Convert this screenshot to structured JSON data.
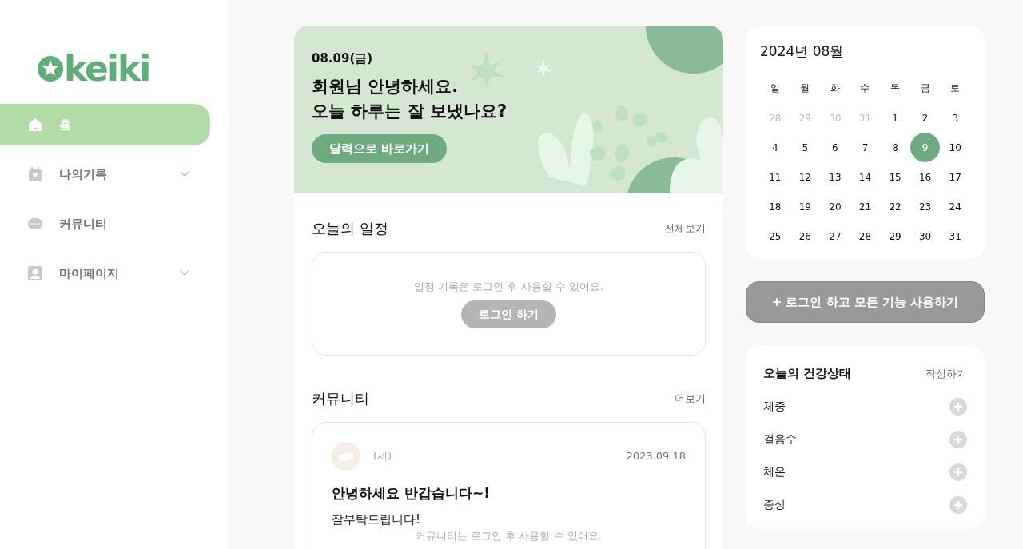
{
  "logo": {
    "text": "keiki"
  },
  "sidebar": {
    "items": [
      {
        "label": "홈",
        "kind": "home",
        "selected": true,
        "expandable": false
      },
      {
        "label": "나의기록",
        "kind": "calendar",
        "selected": false,
        "expandable": true
      },
      {
        "label": "커뮤니티",
        "kind": "chat",
        "selected": false,
        "expandable": false
      },
      {
        "label": "마이페이지",
        "kind": "person",
        "selected": false,
        "expandable": true
      }
    ]
  },
  "banner": {
    "date": "08.09(금)",
    "greeting": [
      "회원님 안녕하세요.",
      "오늘 하루는 잘 보냈나요?"
    ],
    "button": "달력으로 바로가기"
  },
  "schedule": {
    "title": "오늘의 일정",
    "link": "전체보기",
    "message": "일정 기록은 로그인 후 사용할 수 있어요.",
    "button": "로그인 하기"
  },
  "community": {
    "title": "커뮤니티",
    "link": "더보기",
    "post": {
      "author": "(세)",
      "date": "2023.09.18",
      "title": "안녕하세요 반갑습니다~!",
      "body": "잘부탁드립니다!"
    },
    "message": "커뮤니티는 로그인 후 사용할 수 있어요."
  },
  "calendar": {
    "title": "2024년 08월",
    "weekdays": [
      "일",
      "월",
      "화",
      "수",
      "목",
      "금",
      "토"
    ],
    "days": [
      {
        "label": "28",
        "muted": true,
        "selected": false
      },
      {
        "label": "29",
        "muted": true,
        "selected": false
      },
      {
        "label": "30",
        "muted": true,
        "selected": false
      },
      {
        "label": "31",
        "muted": true,
        "selected": false
      },
      {
        "label": "1",
        "muted": false,
        "selected": false
      },
      {
        "label": "2",
        "muted": false,
        "selected": false
      },
      {
        "label": "3",
        "muted": false,
        "selected": false
      },
      {
        "label": "4",
        "muted": false,
        "selected": false
      },
      {
        "label": "5",
        "muted": false,
        "selected": false
      },
      {
        "label": "6",
        "muted": false,
        "selected": false
      },
      {
        "label": "7",
        "muted": false,
        "selected": false
      },
      {
        "label": "8",
        "muted": false,
        "selected": false
      },
      {
        "label": "9",
        "muted": false,
        "selected": true
      },
      {
        "label": "10",
        "muted": false,
        "selected": false
      },
      {
        "label": "11",
        "muted": false,
        "selected": false
      },
      {
        "label": "12",
        "muted": false,
        "selected": false
      },
      {
        "label": "13",
        "muted": false,
        "selected": false
      },
      {
        "label": "14",
        "muted": false,
        "selected": false
      },
      {
        "label": "15",
        "muted": false,
        "selected": false
      },
      {
        "label": "16",
        "muted": false,
        "selected": false
      },
      {
        "label": "17",
        "muted": false,
        "selected": false
      },
      {
        "label": "18",
        "muted": false,
        "selected": false
      },
      {
        "label": "19",
        "muted": false,
        "selected": false
      },
      {
        "label": "20",
        "muted": false,
        "selected": false
      },
      {
        "label": "21",
        "muted": false,
        "selected": false
      },
      {
        "label": "22",
        "muted": false,
        "selected": false
      },
      {
        "label": "23",
        "muted": false,
        "selected": false
      },
      {
        "label": "24",
        "muted": false,
        "selected": false
      },
      {
        "label": "25",
        "muted": false,
        "selected": false
      },
      {
        "label": "26",
        "muted": false,
        "selected": false
      },
      {
        "label": "27",
        "muted": false,
        "selected": false
      },
      {
        "label": "28",
        "muted": false,
        "selected": false
      },
      {
        "label": "29",
        "muted": false,
        "selected": false
      },
      {
        "label": "30",
        "muted": false,
        "selected": false
      },
      {
        "label": "31",
        "muted": false,
        "selected": false
      }
    ]
  },
  "login_button": "+ 로그인 하고 모든 기능 사용하기",
  "health": {
    "title": "오늘의 건강상태",
    "link": "작성하기",
    "items": [
      "체중",
      "걸음수",
      "체온",
      "증상"
    ]
  }
}
